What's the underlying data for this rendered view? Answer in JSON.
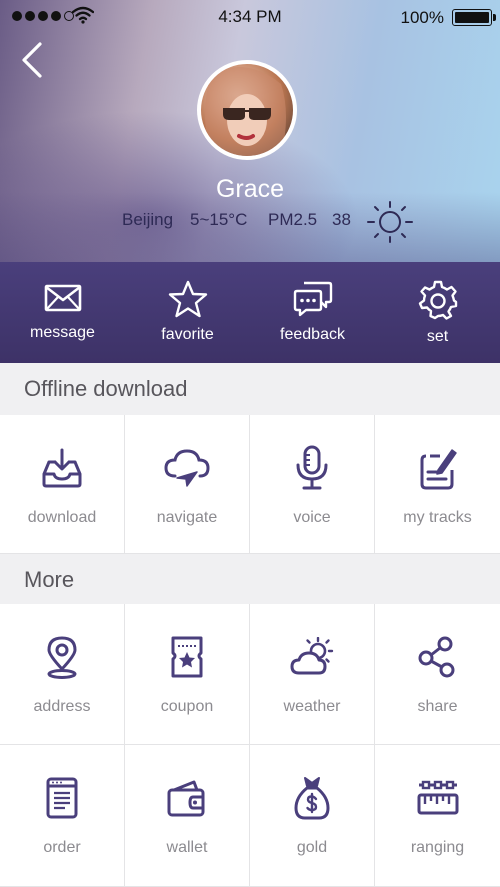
{
  "status_bar": {
    "time": "4:34 PM",
    "battery": "100%"
  },
  "profile": {
    "name": "Grace",
    "city": "Beijing",
    "temperature": "5~15°C",
    "pm_label": "PM2.5",
    "pm_value": "38"
  },
  "actions": [
    {
      "label": "message",
      "icon": "envelope-icon"
    },
    {
      "label": "favorite",
      "icon": "star-icon"
    },
    {
      "label": "feedback",
      "icon": "chat-bubbles-icon"
    },
    {
      "label": "set",
      "icon": "gear-icon"
    }
  ],
  "offline_section": {
    "title": "Offline download",
    "items": [
      {
        "label": "download",
        "icon": "download-tray-icon"
      },
      {
        "label": "navigate",
        "icon": "cloud-navigate-icon"
      },
      {
        "label": "voice",
        "icon": "microphone-icon"
      },
      {
        "label": "my tracks",
        "icon": "clipboard-edit-icon"
      }
    ]
  },
  "more_section": {
    "title": "More",
    "items": [
      {
        "label": "address",
        "icon": "location-pin-icon"
      },
      {
        "label": "coupon",
        "icon": "coupon-ticket-icon"
      },
      {
        "label": "weather",
        "icon": "weather-cloud-sun-icon"
      },
      {
        "label": "share",
        "icon": "share-nodes-icon"
      },
      {
        "label": "order",
        "icon": "order-document-icon"
      },
      {
        "label": "wallet",
        "icon": "wallet-icon"
      },
      {
        "label": "gold",
        "icon": "money-bag-icon"
      },
      {
        "label": "ranging",
        "icon": "ruler-icon"
      }
    ]
  },
  "colors": {
    "accent": "#4a3f7c",
    "icon": "#4a3f7c",
    "label": "#8c8b90"
  }
}
